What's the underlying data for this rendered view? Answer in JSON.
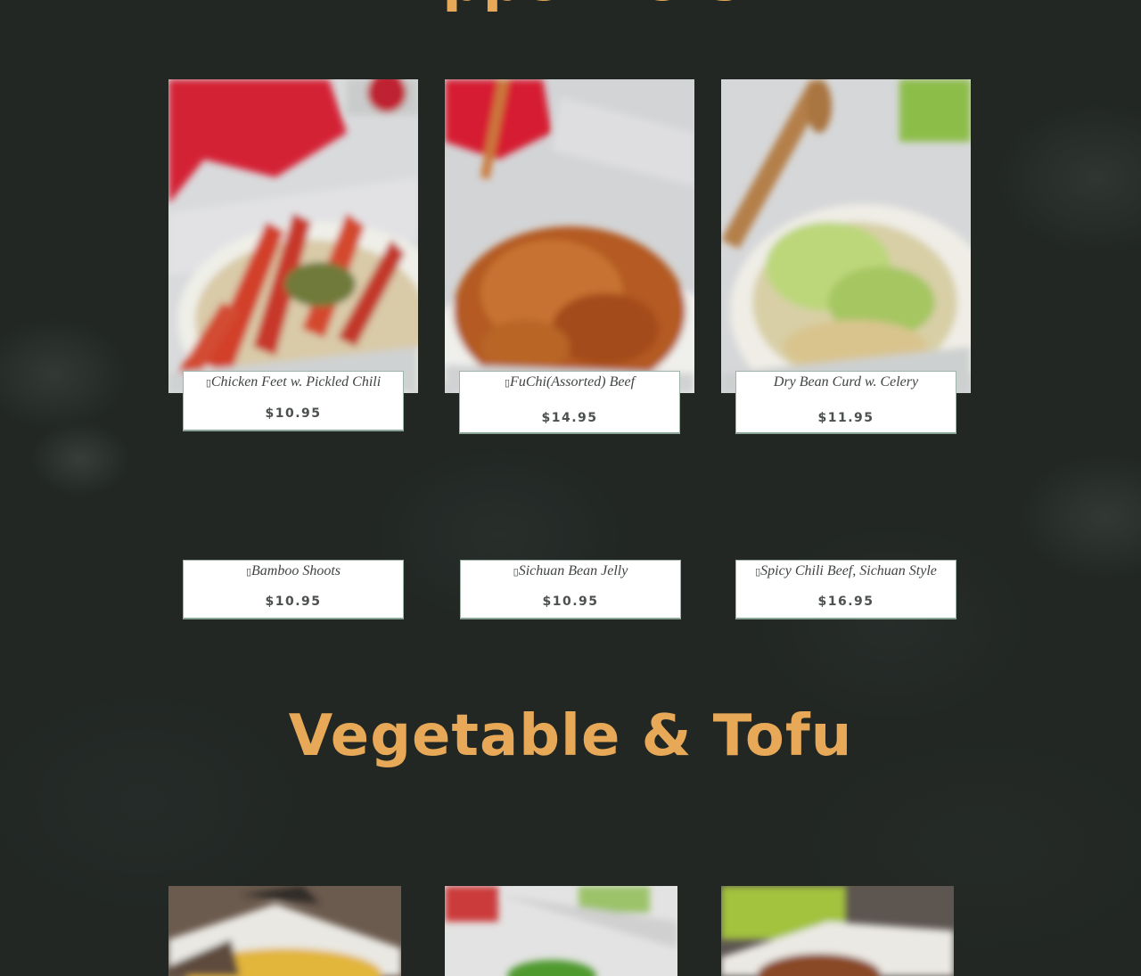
{
  "sections": {
    "top_heading": "Appetizers",
    "veg_heading": "Vegetable & Tofu"
  },
  "appetizers": [
    {
      "name": "Chicken Feet w. Pickled Chili",
      "price": "$10.95",
      "icon": "unknown-glyph-icon"
    },
    {
      "name": "FuChi(Assorted) Beef",
      "price": "$14.95",
      "icon": "unknown-glyph-icon"
    },
    {
      "name": "Dry Bean Curd w. Celery",
      "price": "$11.95"
    },
    {
      "name": "Bamboo Shoots",
      "price": "$10.95",
      "icon": "unknown-glyph-icon"
    },
    {
      "name": "Sichuan Bean Jelly",
      "price": "$10.95",
      "icon": "unknown-glyph-icon"
    },
    {
      "name": "Spicy Chili Beef, Sichuan Style",
      "price": "$16.95",
      "icon": "unknown-glyph-icon"
    }
  ],
  "colors": {
    "heading": "#e7a958",
    "background": "#222724",
    "caption_bg": "#ffffff",
    "caption_border": "#8aa597"
  }
}
